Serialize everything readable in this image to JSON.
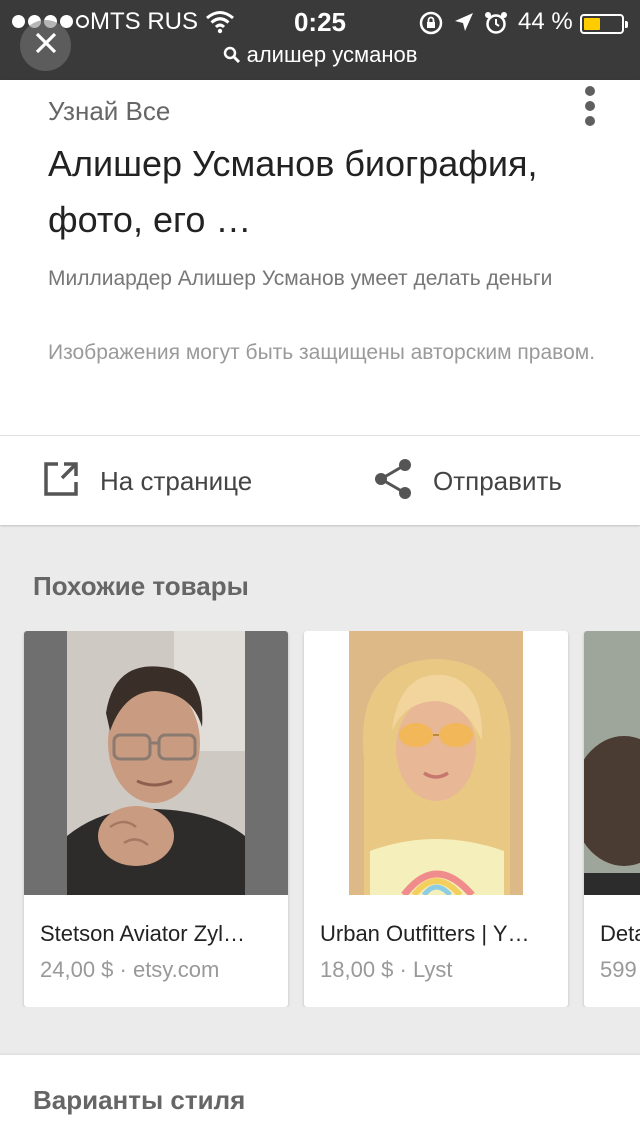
{
  "status_bar": {
    "carrier": "MTS RUS",
    "time": "0:25",
    "battery_percent": "44 %",
    "battery_level": 0.44,
    "signal_bars": 4,
    "signal_max": 5
  },
  "search": {
    "query": "алишер усманов"
  },
  "result": {
    "site": "Узнай Все",
    "title": "Алишер Усманов биография, фото, его …",
    "description": "Миллиардер Алишер Усманов умеет делать деньги",
    "copyright": "Изображения могут быть защищены авторским правом.",
    "visit_label": "На странице",
    "share_label": "Отправить"
  },
  "similar": {
    "title": "Похожие товары",
    "items": [
      {
        "name": "Stetson Aviator Zyl…",
        "meta": "24,00 $ · etsy.com"
      },
      {
        "name": "Urban Outfitters | Y…",
        "meta": "18,00 $ · Lyst"
      },
      {
        "name": "Deta",
        "meta": "599"
      }
    ]
  },
  "styles": {
    "title": "Варианты стиля"
  },
  "colors": {
    "status_bar_bg": "#3a3a3a",
    "battery": "#ffcc00",
    "background": "#ebebeb"
  }
}
